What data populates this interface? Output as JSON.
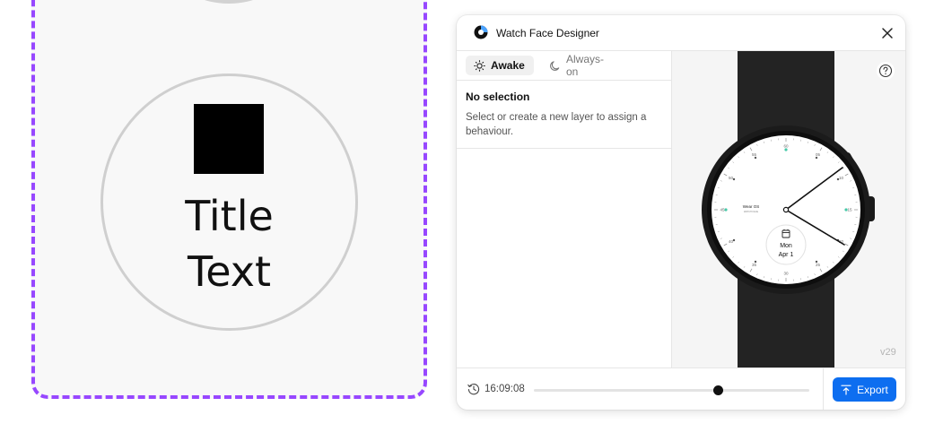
{
  "canvas": {
    "title_text": "Title\nText"
  },
  "window": {
    "title": "Watch Face Designer",
    "tabs": [
      {
        "label": "Awake",
        "icon": "sun-icon",
        "active": true
      },
      {
        "label": "Always-on",
        "icon": "moon-icon",
        "active": false
      }
    ],
    "selection": {
      "title": "No selection",
      "description": "Select or create a new layer to assign a behaviour."
    },
    "preview": {
      "brand_text": "Wear OS",
      "brand_sub": "WATCH FACE",
      "complication_day": "Mon",
      "complication_date": "Apr 1",
      "dial_numbers": [
        "60",
        "05",
        "10",
        "15",
        "20",
        "25",
        "30",
        "35",
        "40",
        "45",
        "50",
        "55"
      ],
      "version": "v29"
    },
    "footer": {
      "time": "16:09:08",
      "scrub_progress": 0.67,
      "export_label": "Export"
    }
  },
  "colors": {
    "frame_dashed": "#9747ff",
    "accent": "#0d6ef0",
    "dial_marker": "#46c9a8"
  }
}
